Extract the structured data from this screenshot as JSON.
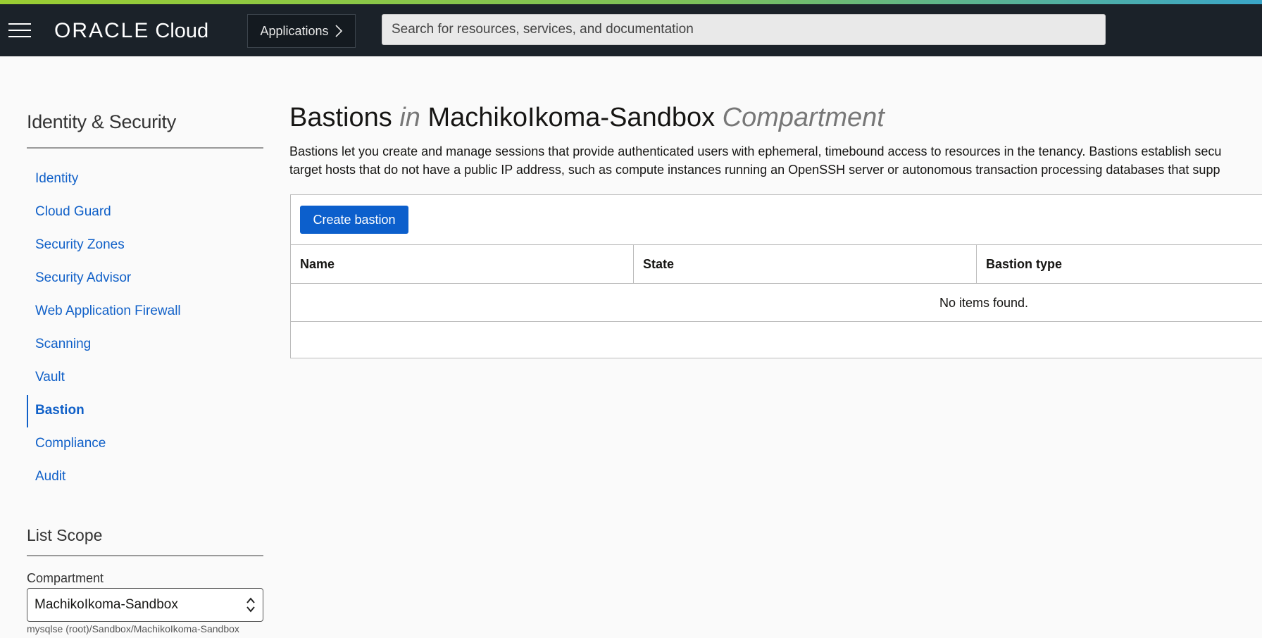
{
  "header": {
    "logo_oracle": "ORACLE",
    "logo_cloud": "Cloud",
    "applications_label": "Applications",
    "search_placeholder": "Search for resources, services, and documentation",
    "accent_colors": [
      "#9acd32",
      "#3aa6c8"
    ],
    "bar_color": "#1b2229"
  },
  "sidebar": {
    "title": "Identity & Security",
    "items": [
      {
        "label": "Identity",
        "active": false
      },
      {
        "label": "Cloud Guard",
        "active": false
      },
      {
        "label": "Security Zones",
        "active": false
      },
      {
        "label": "Security Advisor",
        "active": false
      },
      {
        "label": "Web Application Firewall",
        "active": false
      },
      {
        "label": "Scanning",
        "active": false
      },
      {
        "label": "Vault",
        "active": false
      },
      {
        "label": "Bastion",
        "active": true
      },
      {
        "label": "Compliance",
        "active": false
      },
      {
        "label": "Audit",
        "active": false
      }
    ],
    "scope_title": "List Scope",
    "compartment_label": "Compartment",
    "compartment_value": "MachikoIkoma-Sandbox",
    "compartment_path": "mysqlse (root)/Sandbox/MachikoIkoma-Sandbox"
  },
  "main": {
    "title_resource": "Bastions",
    "title_in": "in",
    "title_compartment": "MachikoIkoma-Sandbox",
    "title_suffix": "Compartment",
    "description_line1": "Bastions let you create and manage sessions that provide authenticated users with ephemeral, timebound access to resources in the tenancy. Bastions establish secu",
    "description_line2": "target hosts that do not have a public IP address, such as compute instances running an OpenSSH server or autonomous transaction processing databases that supp",
    "create_button": "Create bastion",
    "table": {
      "columns": [
        "Name",
        "State",
        "Bastion type"
      ],
      "empty_message": "No items found."
    }
  },
  "colors": {
    "link": "#1060c8",
    "primary_button": "#0c5fcc"
  }
}
